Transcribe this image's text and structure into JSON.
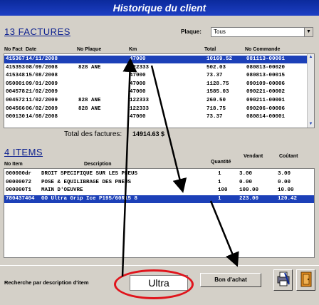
{
  "title": "Historique du client",
  "factures": {
    "section_label": "13 FACTURES",
    "plaque_label": "Plaque:",
    "plaque_value": "Tous",
    "columns": [
      "No Fact",
      "Date",
      "No Plaque",
      "Km",
      "Total",
      "No Commande"
    ],
    "rows": [
      [
        "415367",
        "14/11/2008",
        "",
        "47000",
        "10169.52",
        "081113-00001"
      ],
      [
        "415353",
        "08/09/2008",
        "828 ANE",
        "122333",
        "502.03",
        "080813-00020"
      ],
      [
        "415348",
        "15/08/2008",
        "",
        "47000",
        "73.37",
        "080813-00015"
      ],
      [
        "050001",
        "09/01/2009",
        "",
        "47000",
        "1128.75",
        "090109-00006"
      ],
      [
        "004578",
        "21/02/2009",
        "",
        "47000",
        "1585.03",
        "090221-00002"
      ],
      [
        "004572",
        "11/02/2009",
        "828 ANE",
        "122333",
        "260.50",
        "090211-00001"
      ],
      [
        "004566",
        "06/02/2009",
        "828 ANE",
        "122333",
        "718.75",
        "090206-00006"
      ],
      [
        "000130",
        "14/08/2008",
        "",
        "47000",
        "73.37",
        "080814-00001"
      ]
    ],
    "total_label": "Total des factures:",
    "total_value": "14914.63 $"
  },
  "items": {
    "section_label": "4 ITEMS",
    "columns": [
      "No Item",
      "Description",
      "Quantité",
      "Vendant",
      "Coûtant"
    ],
    "rows": [
      [
        "000000dr",
        "DROIT SPECIFIQUE SUR LES PNEUS",
        "1",
        "3.00",
        "3.00"
      ],
      [
        "00000072",
        "POSE & EQUILIBRAGE DES PNEUS",
        "1",
        "0.00",
        "0.00"
      ],
      [
        "000000T1",
        "MAIN D'OEUVRE",
        "100",
        "100.00",
        "10.00"
      ],
      [
        "780437404",
        "GO Ultra Grip Ice P195/60R15 8",
        "1",
        "223.00",
        "120.42"
      ]
    ]
  },
  "search": {
    "label": "Recherche par description d'item",
    "value": "Ultra"
  },
  "buttons": {
    "bon_achat": "Bon d'achat"
  },
  "colors": {
    "title_bar": "#1d3fc4",
    "selection": "#1c40b8",
    "highlight_oval": "#e0141c"
  }
}
